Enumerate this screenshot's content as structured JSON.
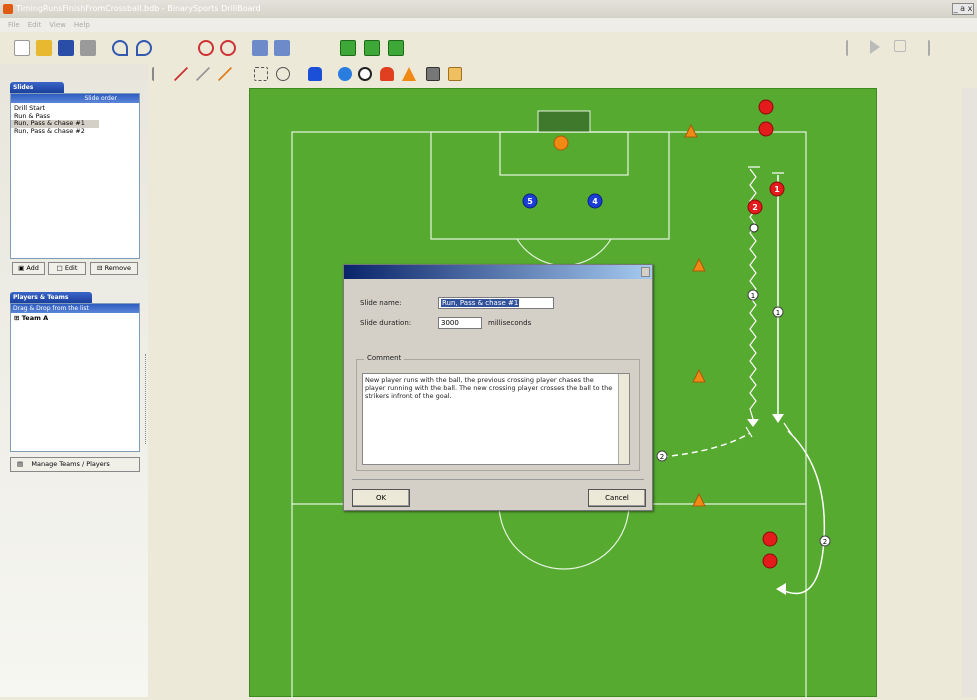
{
  "window": {
    "title": "TimingRunsFinishFromCrossball.bdb - BinarySports DrillBoard",
    "controls": "_ a x"
  },
  "menu": [
    "File",
    "Edit",
    "View",
    "Help"
  ],
  "slides_panel": {
    "header": "Slides",
    "order_label": "Slide order",
    "items": [
      "Drill Start",
      "Run & Pass",
      "Run, Pass & chase #1",
      "Run, Pass & chase #2"
    ],
    "selected_index": 2,
    "add": "Add",
    "edit": "Edit",
    "remove": "Remove"
  },
  "players_panel": {
    "header": "Players & Teams",
    "hint": "Drag & Drop from the list",
    "team": "Team A",
    "manage": "Manage Teams / Players"
  },
  "field": {
    "player_numbers": [
      "5",
      "4",
      "1",
      "2"
    ],
    "arrow_labels": [
      "1",
      "1",
      "2",
      "2"
    ],
    "colors": {
      "grass": "#56aa30",
      "red_player": "#e41b1b",
      "blue_player": "#1b3fd6",
      "keeper": "#f08a14",
      "cone": "#f08a14"
    }
  },
  "dialog": {
    "name_label": "Slide name:",
    "name_value": "Run, Pass & chase #1",
    "duration_label": "Slide duration:",
    "duration_value": "3000",
    "duration_unit": "milliseconds",
    "comment_label": "Comment",
    "comment_text": "New player runs with the ball, the previous crossing player chases the player running with the ball. The new crossing player crosses the ball to the strikers infront of the goal.",
    "ok": "OK",
    "cancel": "Cancel"
  }
}
